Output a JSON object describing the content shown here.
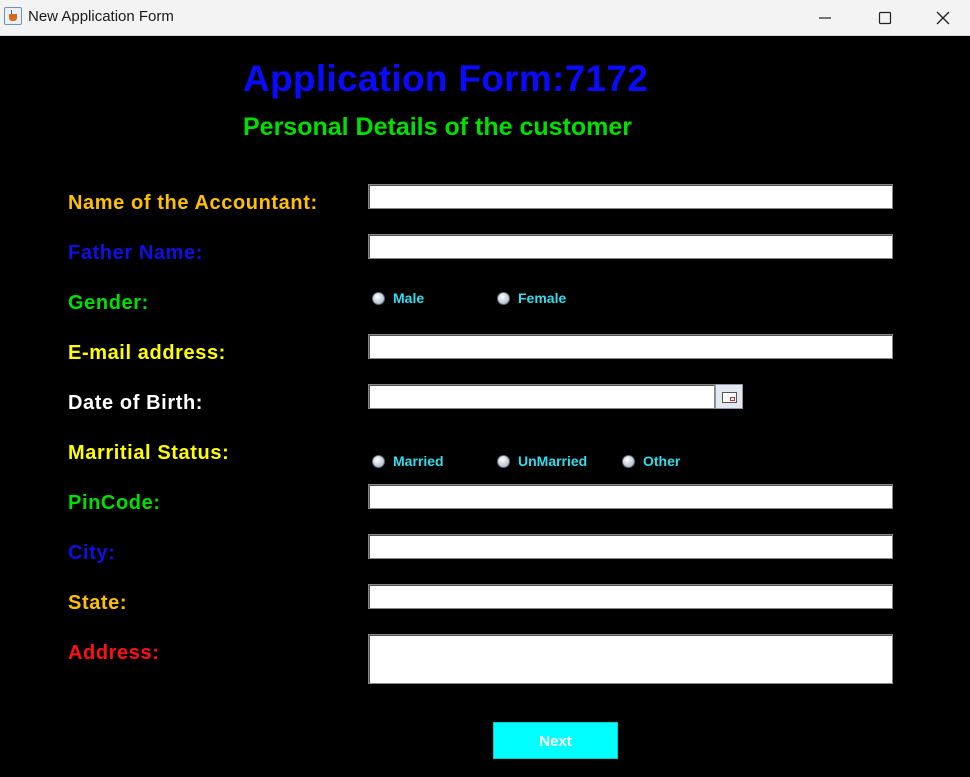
{
  "window": {
    "title": "New Application Form",
    "icon": "java-cup-icon"
  },
  "header": {
    "title": "Application Form:7172",
    "subtitle": "Personal Details of the customer"
  },
  "labels": {
    "name": "Name of the Accountant:",
    "father": "Father Name:",
    "gender": "Gender:",
    "email": "E-mail address:",
    "dob": "Date of Birth:",
    "marital": "Marritial Status:",
    "pincode": "PinCode:",
    "city": "City:",
    "state": "State:",
    "address": "Address:"
  },
  "gender_options": [
    "Male",
    "Female"
  ],
  "marital_options": [
    "Married",
    "UnMarried",
    "Other"
  ],
  "fields": {
    "name": "",
    "father": "",
    "email": "",
    "dob": "",
    "pincode": "",
    "city": "",
    "state": "",
    "address": ""
  },
  "buttons": {
    "next": "Next"
  },
  "colors": {
    "background": "#000000",
    "title": "#0a0aff",
    "subtitle": "#00e000",
    "label_orange": "#ffc000",
    "label_blue": "#1010e0",
    "label_green": "#00e000",
    "label_yellow": "#ffff00",
    "label_white": "#ffffff",
    "label_red": "#ff1010",
    "radio_text": "#33ddee",
    "next_button": "#00ffff"
  }
}
